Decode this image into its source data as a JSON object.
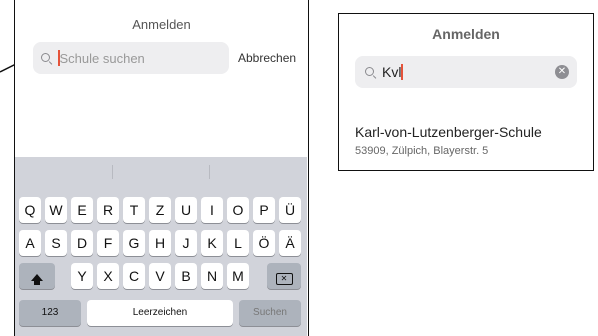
{
  "left_screen": {
    "title": "Anmelden",
    "search": {
      "placeholder": "Schule suchen",
      "icon": "magnifier-icon"
    },
    "cancel_label": "Abbrechen",
    "keyboard": {
      "row1": [
        "Q",
        "W",
        "E",
        "R",
        "T",
        "Z",
        "U",
        "I",
        "O",
        "P",
        "Ü"
      ],
      "row2": [
        "A",
        "S",
        "D",
        "F",
        "G",
        "H",
        "J",
        "K",
        "L",
        "Ö",
        "Ä"
      ],
      "row3": [
        "Y",
        "X",
        "C",
        "V",
        "B",
        "N",
        "M"
      ],
      "numbers_label": "123",
      "space_label": "Leerzeichen",
      "return_label": "Suchen"
    }
  },
  "right_screen": {
    "title": "Anmelden",
    "search": {
      "value": "Kvl",
      "icon": "magnifier-icon"
    },
    "result": {
      "name": "Karl-von-Lutzenberger-Schule",
      "address": "53909, Zülpich, Blayerstr. 5"
    }
  }
}
